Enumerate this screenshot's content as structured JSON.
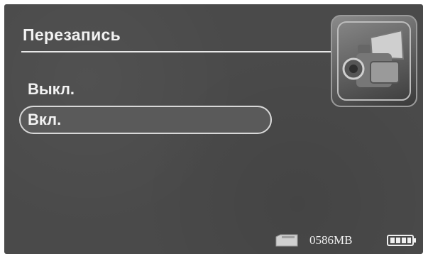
{
  "menu": {
    "title": "Перезапись",
    "items": [
      {
        "label": "Выкл.",
        "selected": false
      },
      {
        "label": "Вкл.",
        "selected": true
      }
    ]
  },
  "status": {
    "storage_text": "0586MB",
    "storage_icon": "sd-card-icon",
    "battery_icon": "battery-full-icon"
  },
  "header_icon": "video-camera-icon"
}
